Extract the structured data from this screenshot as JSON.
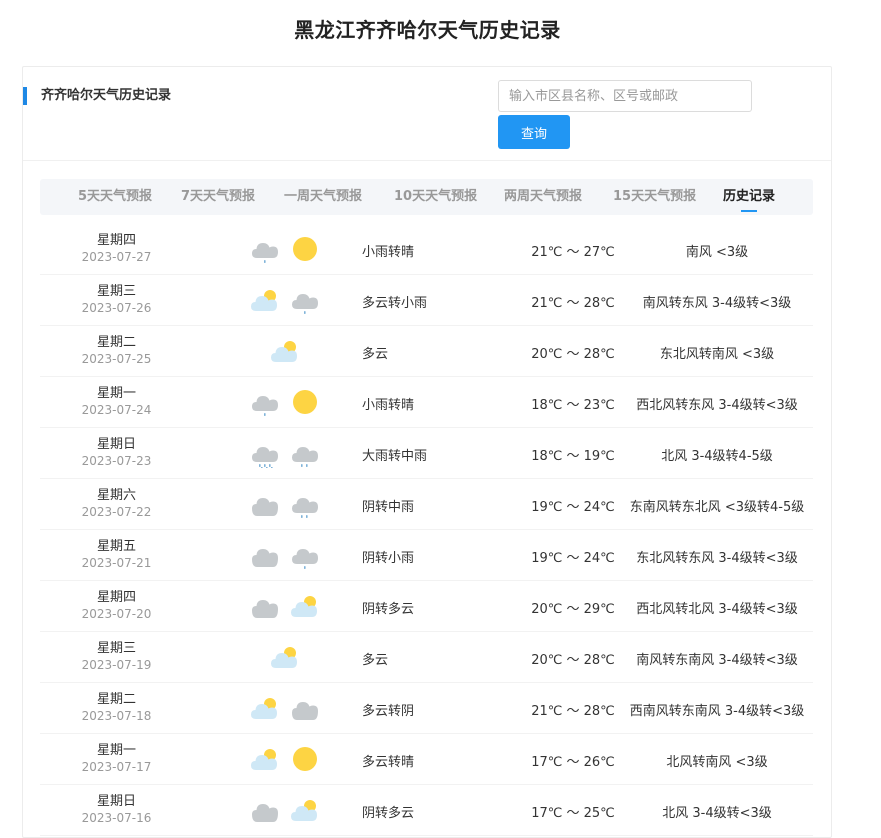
{
  "page_title": "黑龙江齐齐哈尔天气历史记录",
  "section_title": "齐齐哈尔天气历史记录",
  "search": {
    "placeholder": "输入市区县名称、区号或邮政",
    "value": "",
    "button_label": "查询"
  },
  "tabs": [
    {
      "label": "5天天气预报",
      "active": false
    },
    {
      "label": "7天天气预报",
      "active": false
    },
    {
      "label": "一周天气预报",
      "active": false
    },
    {
      "label": "10天天气预报",
      "active": false
    },
    {
      "label": "两周天气预报",
      "active": false
    },
    {
      "label": "15天天气预报",
      "active": false
    },
    {
      "label": "历史记录",
      "active": true
    }
  ],
  "colors": {
    "accent": "#2196f3",
    "sun": "#fdd443",
    "cloud_dark": "#c5c9cc",
    "cloud_light": "#cfe8f6",
    "rain": "#7fb3d9"
  },
  "rows": [
    {
      "weekday": "星期四",
      "date": "2023-07-27",
      "icons": [
        "light-rain-icon",
        "sunny-icon"
      ],
      "desc": "小雨转晴",
      "temp": "21℃ ～ 27℃",
      "wind": "南风 <3级"
    },
    {
      "weekday": "星期三",
      "date": "2023-07-26",
      "icons": [
        "partly-cloudy-icon",
        "light-rain-icon"
      ],
      "desc": "多云转小雨",
      "temp": "21℃ ～ 28℃",
      "wind": "南风转东风 3-4级转<3级"
    },
    {
      "weekday": "星期二",
      "date": "2023-07-25",
      "icons": [
        "partly-cloudy-icon"
      ],
      "desc": "多云",
      "temp": "20℃ ～ 28℃",
      "wind": "东北风转南风 <3级"
    },
    {
      "weekday": "星期一",
      "date": "2023-07-24",
      "icons": [
        "light-rain-icon",
        "sunny-icon"
      ],
      "desc": "小雨转晴",
      "temp": "18℃ ～ 23℃",
      "wind": "西北风转东风 3-4级转<3级"
    },
    {
      "weekday": "星期日",
      "date": "2023-07-23",
      "icons": [
        "heavy-rain-icon",
        "moderate-rain-icon"
      ],
      "desc": "大雨转中雨",
      "temp": "18℃ ～ 19℃",
      "wind": "北风 3-4级转4-5级"
    },
    {
      "weekday": "星期六",
      "date": "2023-07-22",
      "icons": [
        "overcast-icon",
        "moderate-rain-icon"
      ],
      "desc": "阴转中雨",
      "temp": "19℃ ～ 24℃",
      "wind": "东南风转东北风 <3级转4-5级"
    },
    {
      "weekday": "星期五",
      "date": "2023-07-21",
      "icons": [
        "overcast-icon",
        "light-rain-icon"
      ],
      "desc": "阴转小雨",
      "temp": "19℃ ～ 24℃",
      "wind": "东北风转东风 3-4级转<3级"
    },
    {
      "weekday": "星期四",
      "date": "2023-07-20",
      "icons": [
        "overcast-icon",
        "partly-cloudy-icon"
      ],
      "desc": "阴转多云",
      "temp": "20℃ ～ 29℃",
      "wind": "西北风转北风 3-4级转<3级"
    },
    {
      "weekday": "星期三",
      "date": "2023-07-19",
      "icons": [
        "partly-cloudy-icon"
      ],
      "desc": "多云",
      "temp": "20℃ ～ 28℃",
      "wind": "南风转东南风 3-4级转<3级"
    },
    {
      "weekday": "星期二",
      "date": "2023-07-18",
      "icons": [
        "partly-cloudy-icon",
        "overcast-icon"
      ],
      "desc": "多云转阴",
      "temp": "21℃ ～ 28℃",
      "wind": "西南风转东南风 3-4级转<3级"
    },
    {
      "weekday": "星期一",
      "date": "2023-07-17",
      "icons": [
        "partly-cloudy-icon",
        "sunny-icon"
      ],
      "desc": "多云转晴",
      "temp": "17℃ ～ 26℃",
      "wind": "北风转南风 <3级"
    },
    {
      "weekday": "星期日",
      "date": "2023-07-16",
      "icons": [
        "overcast-icon",
        "partly-cloudy-icon"
      ],
      "desc": "阴转多云",
      "temp": "17℃ ～ 25℃",
      "wind": "北风 3-4级转<3级"
    }
  ]
}
